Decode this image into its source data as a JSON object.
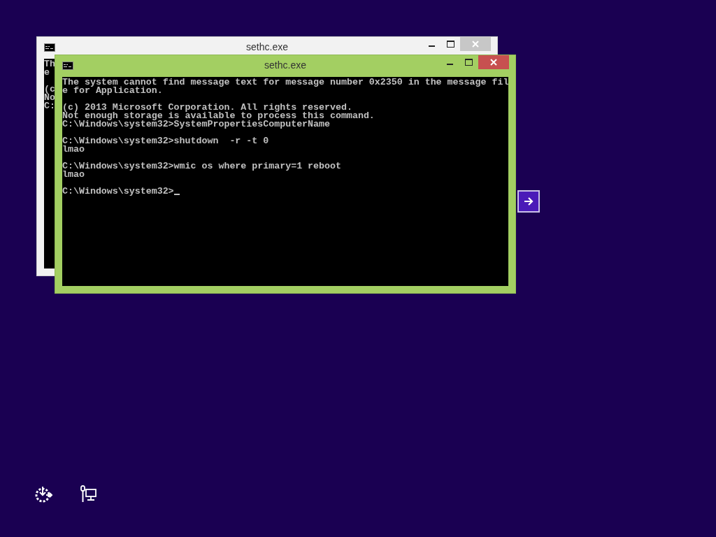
{
  "windows": [
    {
      "title": "sethc.exe",
      "active": false,
      "blocks": [
        [
          "Th",
          "e"
        ],
        [
          "(c",
          "No",
          "C:"
        ]
      ]
    },
    {
      "title": "sethc.exe",
      "active": true,
      "blocks": [
        [
          "The system cannot find message text for message number 0x2350 in the message fil",
          "e for Application."
        ],
        [
          "(c) 2013 Microsoft Corporation. All rights reserved.",
          "Not enough storage is available to process this command.",
          "C:\\Windows\\system32>SystemPropertiesComputerName"
        ],
        [
          "C:\\Windows\\system32>shutdown  -r -t 0",
          "lmao"
        ],
        [
          "C:\\Windows\\system32>wmic os where primary=1 reboot",
          "lmao"
        ],
        [
          "C:\\Windows\\system32>"
        ]
      ]
    }
  ]
}
